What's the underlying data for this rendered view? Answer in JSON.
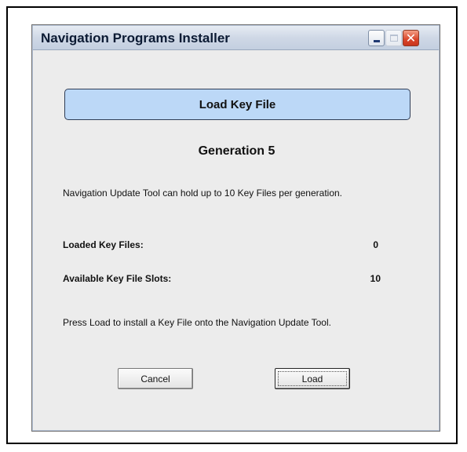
{
  "window": {
    "title": "Navigation Programs Installer",
    "controls": {
      "minimize_icon": "minimize-icon",
      "maximize_icon": "maximize-icon",
      "close_icon": "close-icon"
    }
  },
  "header": {
    "label": "Load Key File"
  },
  "generation": {
    "text": "Generation 5"
  },
  "info": {
    "text": "Navigation Update Tool can hold up to 10 Key Files per generation."
  },
  "stats": {
    "loaded_label": "Loaded Key Files:",
    "loaded_value": "0",
    "available_label": "Available Key File Slots:",
    "available_value": "10"
  },
  "instruction": {
    "text": "Press Load to install a Key File onto the Navigation Update Tool."
  },
  "buttons": {
    "cancel_label": "Cancel",
    "load_label": "Load"
  },
  "colors": {
    "header_fill": "#bcd8f7",
    "close_button": "#d9452a",
    "window_bg": "#ececec"
  }
}
